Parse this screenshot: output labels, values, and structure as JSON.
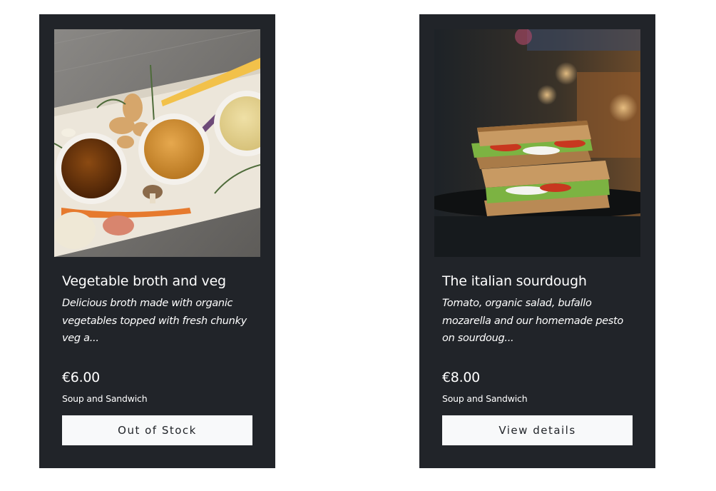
{
  "products": [
    {
      "image_alt": "Bowls of broth with ginger, carrots and herbs",
      "title": "Vegetable broth and veg",
      "description": "Delicious broth made with organic vegetables topped with fresh chunky veg a...",
      "price": "€6.00",
      "category": "Soup and Sandwich",
      "button_label": "Out of Stock"
    },
    {
      "image_alt": "Stacked tomato mozzarella sourdough sandwich",
      "title": "The italian sourdough",
      "description": "Tomato, organic salad, bufallo mozarella and our homemade pesto on sourdoug...",
      "price": "€8.00",
      "category": "Soup and Sandwich",
      "button_label": "View details"
    }
  ],
  "colors": {
    "card_background": "#212429",
    "button_background": "#f8f9fa",
    "page_background": "#ffffff"
  }
}
